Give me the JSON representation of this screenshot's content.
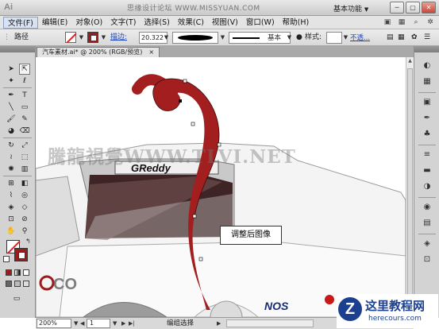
{
  "app": {
    "logo": "Ai",
    "title": "思缘设计论坛 WWW.MISSYUAN.COM",
    "workspace": "基本功能",
    "window_buttons": [
      "minimize-icon",
      "maximize-icon",
      "close-icon"
    ]
  },
  "menu": {
    "items": [
      "文件(F)",
      "编辑(E)",
      "对象(O)",
      "文字(T)",
      "选择(S)",
      "效果(C)",
      "视图(V)",
      "窗口(W)",
      "帮助(H)"
    ],
    "extra_icons": [
      "bridge-icon",
      "arrange-icon",
      "search-icon",
      "star-icon"
    ]
  },
  "control_bar": {
    "selection_type": "路径",
    "stroke_label": "描边:",
    "stroke_weight": "20.322",
    "profile": "基本",
    "style_label": "样式:",
    "opacity_label": "不透..."
  },
  "document": {
    "tab_label": "汽车素材.ai* @ 200% (RGB/预览)",
    "tab_close": "×"
  },
  "tools": {
    "items": [
      "selection-tool-icon",
      "direct-selection-tool-icon",
      "magic-wand-icon",
      "lasso-icon",
      "pen-icon",
      "type-icon",
      "line-icon",
      "rectangle-icon",
      "paintbrush-icon",
      "pencil-icon",
      "blob-brush-icon",
      "eraser-icon",
      "rotate-icon",
      "scale-icon",
      "warp-icon",
      "free-transform-icon",
      "symbol-sprayer-icon",
      "column-graph-icon",
      "mesh-icon",
      "gradient-icon",
      "eyedropper-icon",
      "blend-icon",
      "live-paint-icon",
      "live-paint-select-icon",
      "artboard-icon",
      "slice-icon",
      "hand-icon",
      "zoom-icon"
    ],
    "fill_color": "#ffffff",
    "stroke_color": "#9c1b1b"
  },
  "canvas": {
    "callout": "调整后图像",
    "watermark": "騰龍視覺WWW.TLVI.NET",
    "banner_text": "GReddy",
    "badge_text": "NOS",
    "car_logo_text": "CO",
    "swirl_color": "#a31e1e"
  },
  "status": {
    "zoom": "200%",
    "page": "1",
    "tool_status": "编组选择"
  },
  "site_logo": {
    "mark": "Z",
    "name_cn": "这里教程网",
    "name_en": "herecours.com"
  }
}
